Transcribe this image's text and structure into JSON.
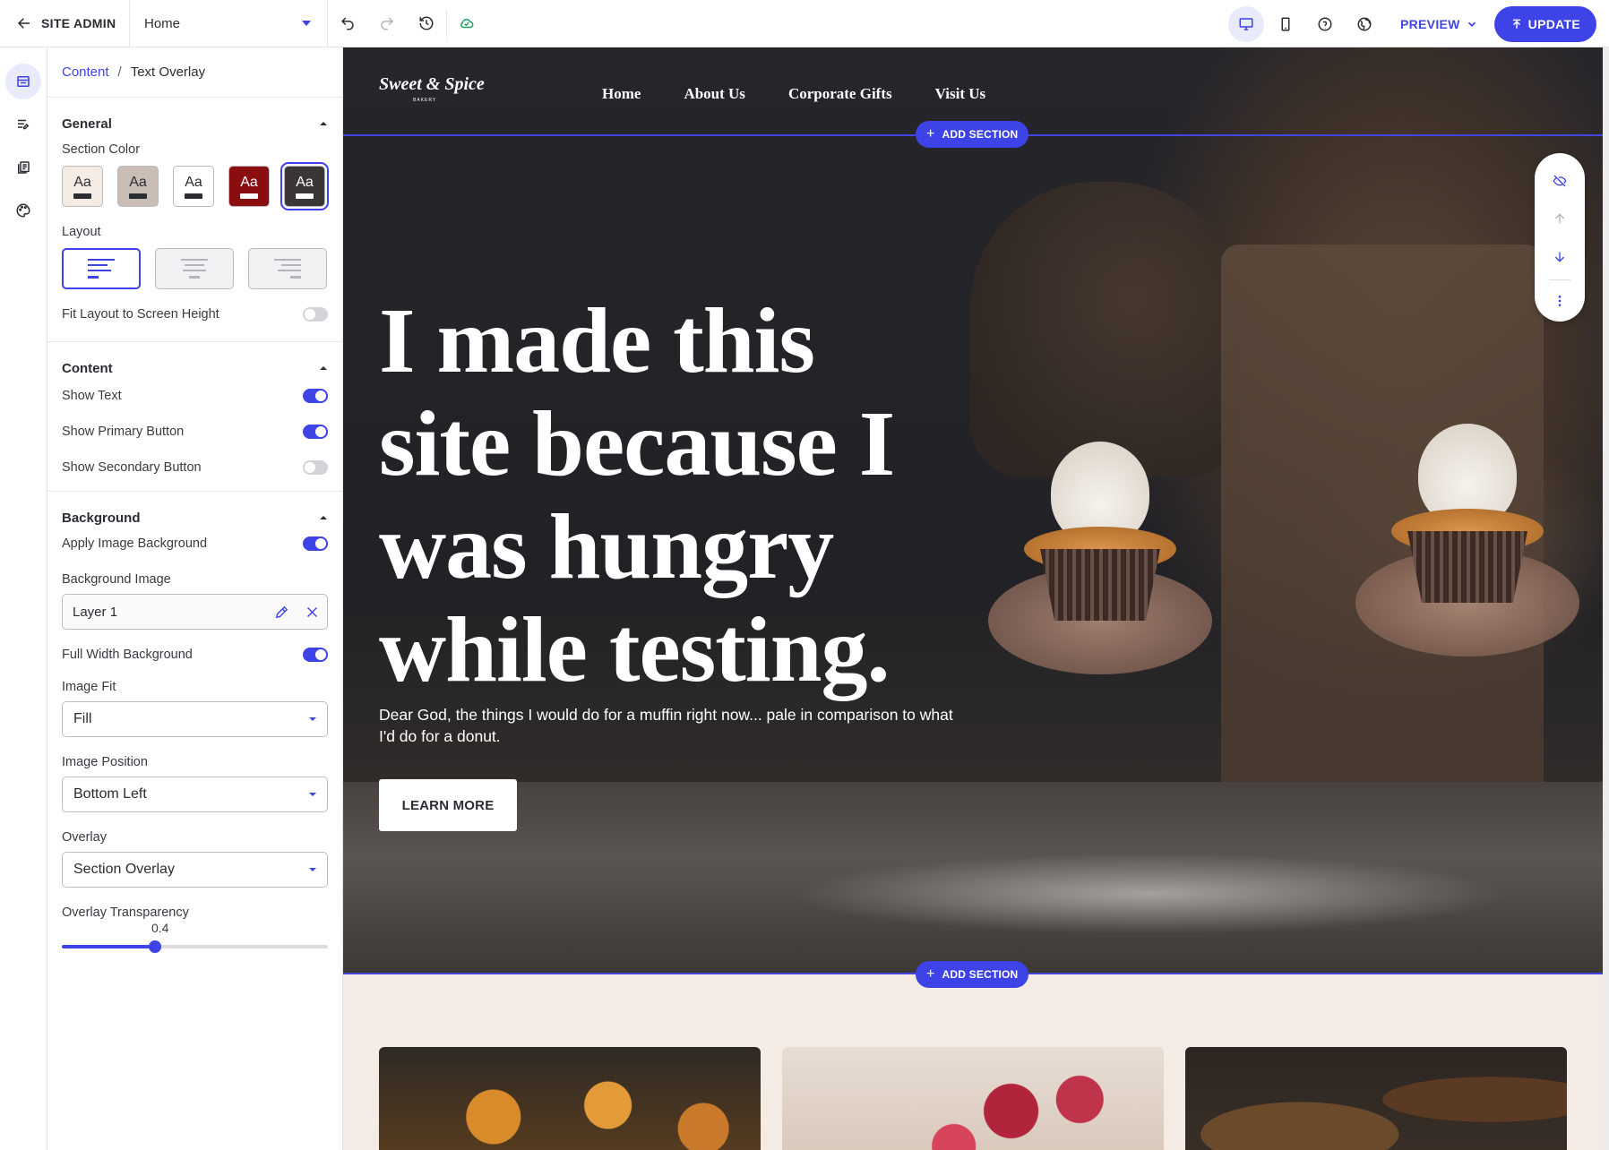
{
  "topbar": {
    "back_label": "SITE ADMIN",
    "page_select": "Home",
    "preview_label": "PREVIEW",
    "update_label": "UPDATE"
  },
  "panel": {
    "breadcrumb": {
      "parent": "Content",
      "separator": "/",
      "current": "Text Overlay"
    },
    "general": {
      "title": "General",
      "section_color_label": "Section Color",
      "swatches": [
        {
          "text": "Aa",
          "bg": "#f4ece4",
          "fg": "#2c2c33",
          "bar": "#2c2c33",
          "selected": false
        },
        {
          "text": "Aa",
          "bg": "#c9bdb5",
          "fg": "#2c2c33",
          "bar": "#2c2c33",
          "selected": false
        },
        {
          "text": "Aa",
          "bg": "#ffffff",
          "fg": "#2c2c33",
          "bar": "#2c2c33",
          "selected": false
        },
        {
          "text": "Aa",
          "bg": "#8a0d10",
          "fg": "#ffffff",
          "bar": "#ffffff",
          "selected": false
        },
        {
          "text": "Aa",
          "bg": "#3a3636",
          "fg": "#ffffff",
          "bar": "#ffffff",
          "selected": true
        }
      ],
      "layout_label": "Layout",
      "fit_label": "Fit Layout to Screen Height",
      "fit_on": false
    },
    "content": {
      "title": "Content",
      "show_text_label": "Show Text",
      "show_text_on": true,
      "show_primary_label": "Show Primary Button",
      "show_primary_on": true,
      "show_secondary_label": "Show Secondary Button",
      "show_secondary_on": false
    },
    "background": {
      "title": "Background",
      "apply_image_label": "Apply Image Background",
      "apply_image_on": true,
      "bg_image_label": "Background Image",
      "bg_image_value": "Layer 1",
      "full_width_label": "Full Width Background",
      "full_width_on": true,
      "image_fit_label": "Image Fit",
      "image_fit_value": "Fill",
      "image_position_label": "Image Position",
      "image_position_value": "Bottom Left",
      "overlay_label": "Overlay",
      "overlay_value": "Section Overlay",
      "transparency_label": "Overlay Transparency",
      "transparency_value": "0.4",
      "transparency_fraction": 0.35
    }
  },
  "site": {
    "logo": "Sweet & Spice",
    "logo_sub": "BAKERY",
    "nav": [
      "Home",
      "About Us",
      "Corporate Gifts",
      "Visit Us"
    ],
    "add_section_label": "ADD SECTION",
    "headline_lines": [
      "I made this",
      "site because I",
      "was hungry",
      "while testing."
    ],
    "subtext": "Dear God, the things I would do for a muffin right now... pale in comparison to what I'd do for a donut.",
    "button_label": "LEARN MORE"
  },
  "colors": {
    "accent": "#3d43e6"
  }
}
